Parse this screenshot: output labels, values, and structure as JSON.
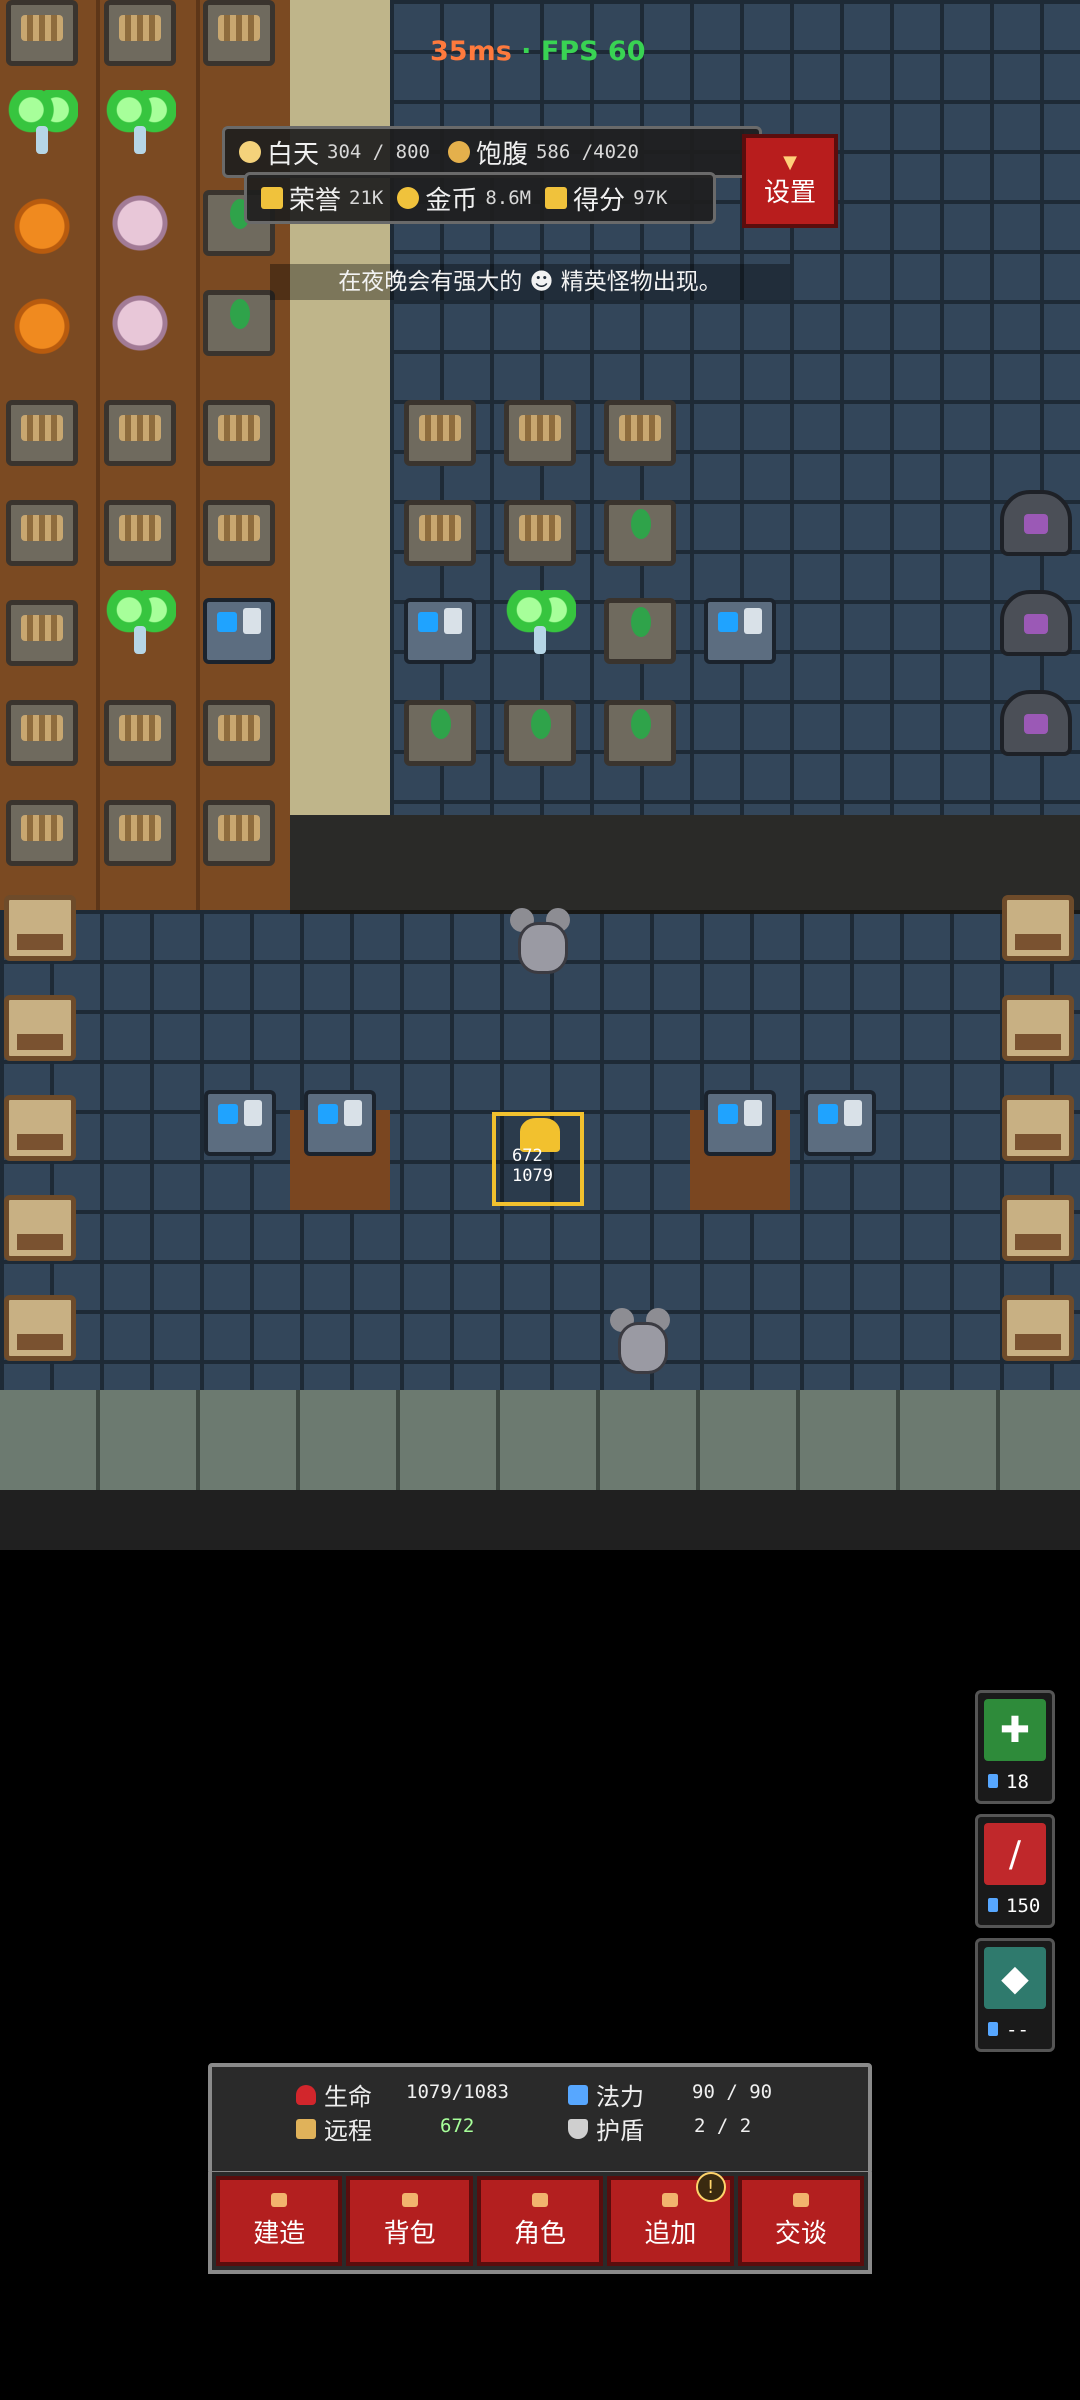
{
  "fps_display": {
    "ping": "35ms",
    "separator": " · ",
    "fps": "FPS 60"
  },
  "status_bar": {
    "day_label": "白天",
    "day_value": "304 / 800",
    "satiety_label": "饱腹",
    "satiety_value": "586 /4020"
  },
  "resource_bar": {
    "honor_label": "荣誉",
    "honor_value": "21K",
    "gold_label": "金币",
    "gold_value": "8.6M",
    "score_label": "得分",
    "score_value": "97K"
  },
  "settings_button": {
    "label": "设置"
  },
  "notice": {
    "text": "在夜晚会有强大的 ☻ 精英怪物出现。"
  },
  "player": {
    "ranged": "672",
    "hp": "1079"
  },
  "skills": [
    {
      "name": "skill-1",
      "cost": "18",
      "color": "#2e8b3a",
      "glyph": "✚"
    },
    {
      "name": "skill-2",
      "cost": "150",
      "color": "#c0282b",
      "glyph": "/"
    },
    {
      "name": "skill-3",
      "cost": "--",
      "color": "#2f7a6d",
      "glyph": "◆"
    }
  ],
  "stats": {
    "hp_label": "生命",
    "hp_value": "1079/1083",
    "ranged_label": "远程",
    "ranged_value": "672",
    "mana_label": "法力",
    "mana_value": "90 / 90",
    "shield_label": "护盾",
    "shield_value": "2 / 2"
  },
  "menu": [
    {
      "label": "建造"
    },
    {
      "label": "背包"
    },
    {
      "label": "角色"
    },
    {
      "label": "追加",
      "badge": "!"
    },
    {
      "label": "交谈"
    }
  ],
  "colors": {
    "accent_red": "#b31f1f",
    "fps_green": "#39d353",
    "ping_orange": "#ff7a3d"
  }
}
